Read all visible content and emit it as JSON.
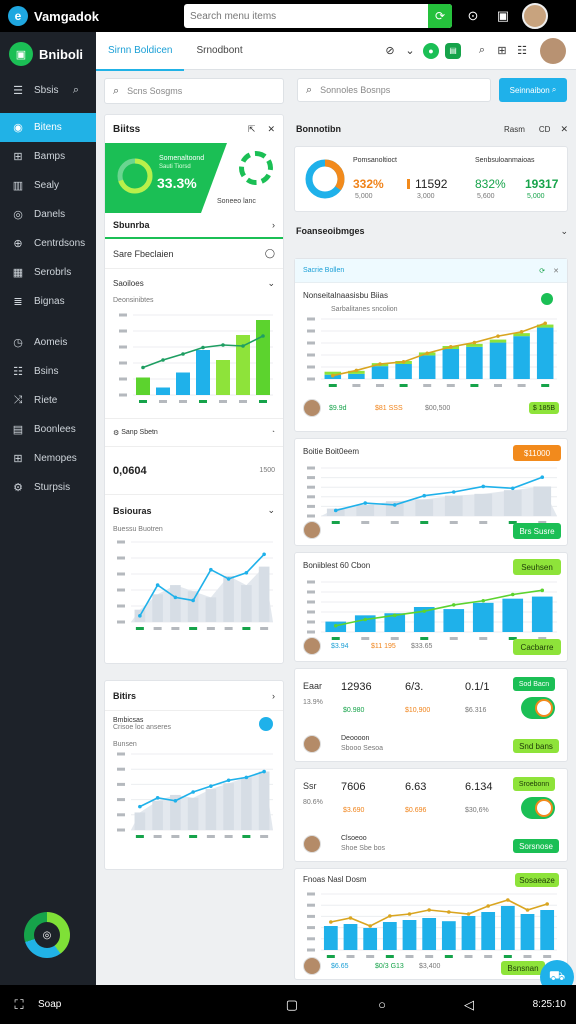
{
  "topbar": {
    "app_name": "Vamgadok",
    "search_placeholder": "Search menu items",
    "go_icon": "refresh-icon"
  },
  "sidebar": {
    "brand": "Bniboli",
    "menu_label": "Sbsis",
    "items": [
      {
        "label": "Bitens",
        "icon": "dashboard-icon",
        "active": true
      },
      {
        "label": "Bamps",
        "icon": "grid-icon"
      },
      {
        "label": "Sealy",
        "icon": "chart-icon"
      },
      {
        "label": "Danels",
        "icon": "compass-icon"
      },
      {
        "label": "Centrdsons",
        "icon": "globe-icon"
      },
      {
        "label": "Serobrls",
        "icon": "table-icon"
      },
      {
        "label": "Bignas",
        "icon": "layers-icon"
      },
      {
        "label": "Aomeis",
        "icon": "clock-icon"
      },
      {
        "label": "Bsins",
        "icon": "list-icon"
      },
      {
        "label": "Riete",
        "icon": "shuffle-icon"
      },
      {
        "label": "Boonlees",
        "icon": "calendar-icon"
      },
      {
        "label": "Nemopes",
        "icon": "grid-icon"
      },
      {
        "label": "Sturpsis",
        "icon": "gear-icon"
      }
    ]
  },
  "subheader": {
    "tabs": [
      "Sirnn Boldicen",
      "Srnodbont"
    ]
  },
  "left_panel": {
    "search_placeholder": "Scns Sosgms",
    "card_title": "Biitss",
    "banner": {
      "heading": "Somenaltoond",
      "subheading": "Sauti Tiorsd",
      "percent": "33.3%",
      "footer": "Soneeo  lanc",
      "ring_percent": 70
    },
    "section_title": "Sbunrba",
    "row1": "Sare Fbeclaien",
    "row2": "Saoiloes",
    "chart1": {
      "title": "Deonsinibtes",
      "value_label": "Sanp Sbetn",
      "value": "0,0604",
      "value_side": "1500"
    },
    "section2_title": "Bsiouras",
    "chart2": {
      "title": "Buessu Buotren"
    },
    "section3_title": "Bitirs",
    "chart3": {
      "title": "Bmbicsas",
      "subtitle": "Crisoe loc anseres",
      "chart_label": "Bunsen"
    }
  },
  "right_panel": {
    "search_placeholder": "Sonnoles Bosnps",
    "search_button": "Seinnaibon",
    "header_title": "Bonnotibn",
    "header_action": "Rasm",
    "header_action2": "CD",
    "stats": [
      {
        "title": "Pomsanoltioct",
        "value": "332%",
        "sub": "5,000"
      },
      {
        "value": "11592",
        "sub": "3,000"
      },
      {
        "title": "Senbsuloanmaioas",
        "value": "832%",
        "sub": "5,600"
      },
      {
        "value": "19317",
        "sub": "5,000"
      }
    ],
    "section_title": "Foanseoibmges",
    "card1": {
      "tag": "Sacrie Bollen",
      "title": "Nonseitalnaasisbu Biias",
      "subtitle": "Sarbalitanes sncolion",
      "footer": [
        "$9.9d",
        "$81 SSS",
        "$00,500"
      ],
      "badge": "$ 185B"
    },
    "card2": {
      "title": "Boitie Boit0eem",
      "button_top": "$11000",
      "button_bottom": "Brs Susre"
    },
    "card3": {
      "title": "Boniiblest 60 Cbon",
      "button_top": "Seuhsen",
      "button_bottom": "Cacbarre",
      "footer": [
        "$3.94",
        "$11 195",
        "$33.65"
      ]
    },
    "stat_card1": {
      "label": "Eaar",
      "label2": "13.9%",
      "col1": "12936",
      "col1_sub": "$0.980",
      "col2": "6/3.",
      "col2_sub": "$10,900",
      "col3": "0.1/1",
      "col3_sub": "$6.316",
      "button_top": "Sod Bacn",
      "person": "Deoooon",
      "person_sub": "Sbooo Sesoa",
      "button_bottom": "Snd bans"
    },
    "stat_card2": {
      "label": "Ssr",
      "label2": "80.6%",
      "col1": "7606",
      "col1_sub": "$3.690",
      "col2": "6.63",
      "col2_sub": "$0.696",
      "col3": "6.134",
      "col3_sub": "$30,6%",
      "button_top": "Sroebonn",
      "person": "Clsoeoo",
      "person_sub": "Shoe Sbe bos",
      "button_bottom": "Sorsnose"
    },
    "card4": {
      "title": "Fnoas Nasl Dosm",
      "button_top": "Sosaeaze",
      "button_bottom": "Bsnsnan",
      "footer": [
        "$6.65",
        "$0/3 G13",
        "$3,400"
      ]
    }
  },
  "navbar": {
    "left_label": "Soap",
    "clock": "8:25:10"
  },
  "colors": {
    "blue": "#1fb1ea",
    "green": "#1bbf55",
    "lime": "#8ee33a",
    "orange": "#f28a1c",
    "sidebar": "#1d2229"
  },
  "chart_data": [
    {
      "type": "bar",
      "name": "left-chart-1",
      "categories": [
        "1",
        "2",
        "3",
        "4",
        "5",
        "6",
        "7"
      ],
      "values": [
        35,
        15,
        45,
        90,
        70,
        120,
        150
      ],
      "line": [
        55,
        70,
        82,
        95,
        100,
        98,
        118
      ],
      "ylim": [
        0,
        160
      ]
    },
    {
      "type": "area",
      "name": "left-chart-2",
      "values": [
        20,
        45,
        60,
        50,
        40,
        75,
        60,
        90
      ],
      "line": [
        10,
        60,
        40,
        35,
        85,
        70,
        80,
        110
      ],
      "ylim": [
        0,
        130
      ]
    },
    {
      "type": "area",
      "name": "left-chart-3",
      "values": [
        30,
        50,
        60,
        55,
        70,
        80,
        90,
        100
      ],
      "line": [
        40,
        55,
        50,
        65,
        75,
        85,
        90,
        100
      ],
      "ylim": [
        0,
        130
      ]
    },
    {
      "type": "bar",
      "name": "right-chart-1",
      "categories": [
        "1",
        "2",
        "3",
        "4",
        "5",
        "6",
        "7",
        "8",
        "9",
        "10"
      ],
      "values": [
        10,
        12,
        30,
        35,
        55,
        70,
        75,
        85,
        100,
        120
      ],
      "line": [
        8,
        20,
        35,
        40,
        60,
        75,
        85,
        100,
        110,
        130
      ],
      "ylim": [
        0,
        140
      ]
    },
    {
      "type": "bar",
      "name": "right-chart-2",
      "values": [
        20,
        30,
        40,
        45,
        55,
        60,
        70,
        80
      ],
      "line": [
        15,
        35,
        30,
        55,
        65,
        80,
        75,
        105
      ],
      "ylim": [
        0,
        130
      ]
    },
    {
      "type": "bar",
      "name": "right-chart-3",
      "values": [
        25,
        40,
        45,
        60,
        55,
        70,
        80,
        85
      ],
      "line": [
        15,
        30,
        40,
        50,
        65,
        75,
        90,
        100
      ],
      "ylim": [
        0,
        120
      ]
    },
    {
      "type": "bar",
      "name": "right-chart-4",
      "values": [
        60,
        65,
        55,
        70,
        75,
        80,
        72,
        85,
        95,
        110,
        90,
        100
      ],
      "line": [
        70,
        80,
        60,
        85,
        90,
        100,
        95,
        90,
        110,
        125,
        100,
        115
      ],
      "ylim": [
        0,
        140
      ]
    }
  ]
}
